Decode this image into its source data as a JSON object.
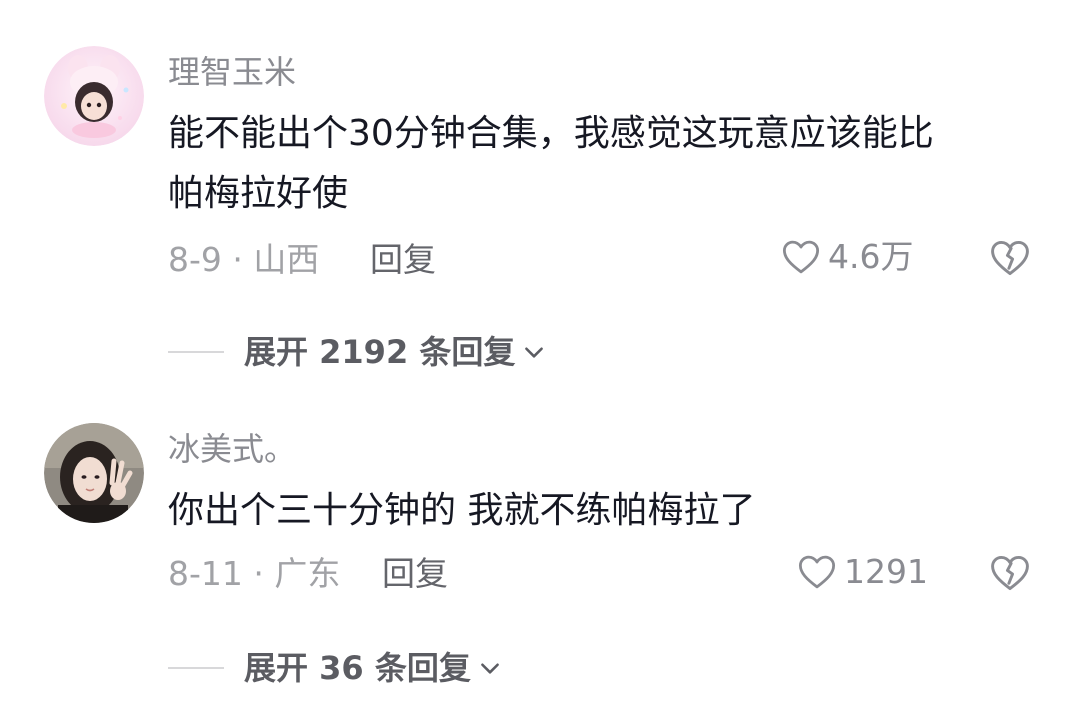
{
  "comments": [
    {
      "username": "理智玉米",
      "content_line1": "能不能出个30分钟合集，我感觉这玩意应该能比",
      "content_line2": "帕梅拉好使",
      "meta": "8-9 · 山西",
      "reply_label": "回复",
      "likes": "4.6万",
      "expand_label": "展开 2192 条回复",
      "avatar_icon": "pink-anime-avatar"
    },
    {
      "username": "冰美式。",
      "content_line1": "你出个三十分钟的 我就不练帕梅拉了",
      "meta": "8-11 · 广东",
      "reply_label": "回复",
      "likes": "1291",
      "expand_label": "展开 36 条回复",
      "avatar_icon": "girl-photo-avatar"
    }
  ],
  "colors": {
    "username": "#8a8b91",
    "content": "#161823",
    "meta": "#a1a2a6",
    "icon": "#8a8b91"
  }
}
